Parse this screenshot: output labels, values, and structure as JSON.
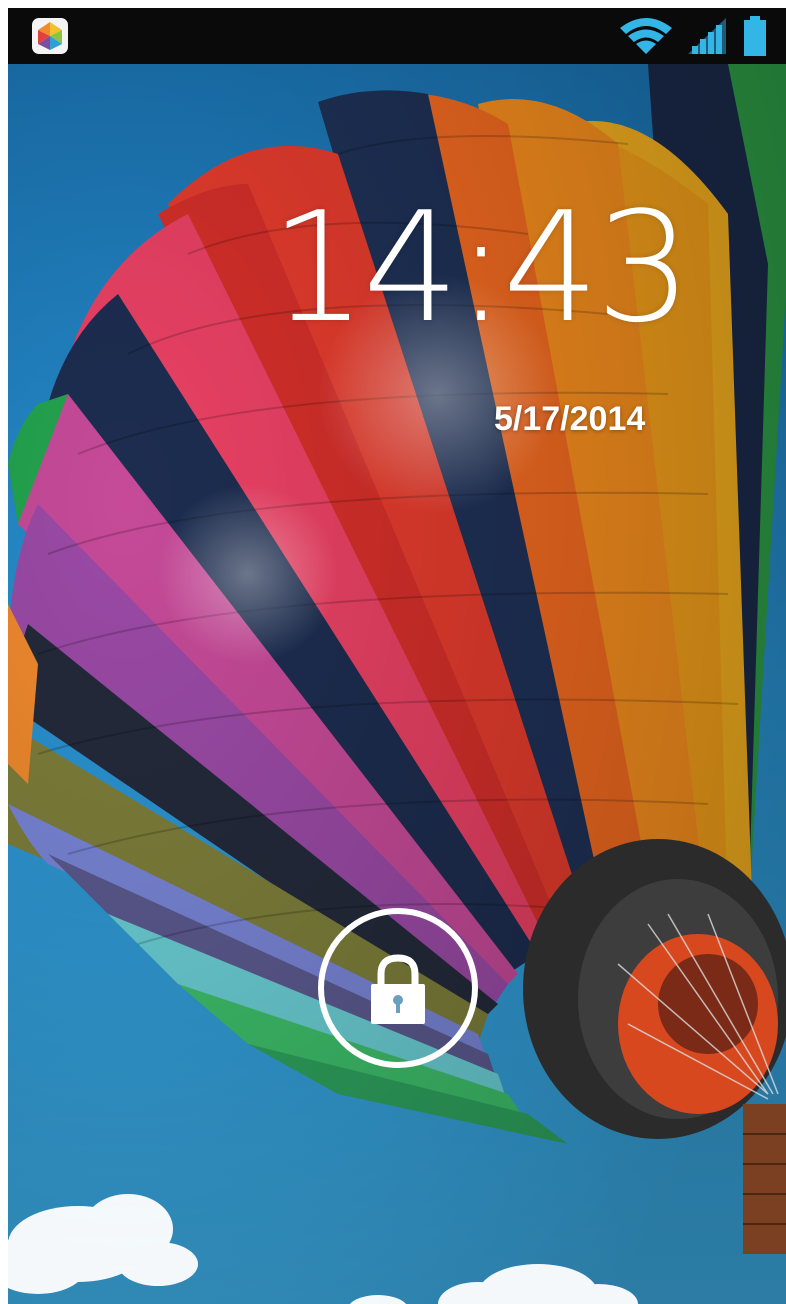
{
  "status_bar": {
    "app_icon": "colorful-app-icon",
    "wifi_icon": "wifi-icon",
    "signal_icon": "cell-signal-icon",
    "battery_icon": "battery-icon",
    "icon_color": "#33b5e5",
    "background": "#0a0a0a"
  },
  "lockscreen": {
    "time": "14:43",
    "date": "5/17/2014",
    "unlock_icon": "lock-icon",
    "wallpaper": "hot-air-balloon-wallpaper"
  }
}
